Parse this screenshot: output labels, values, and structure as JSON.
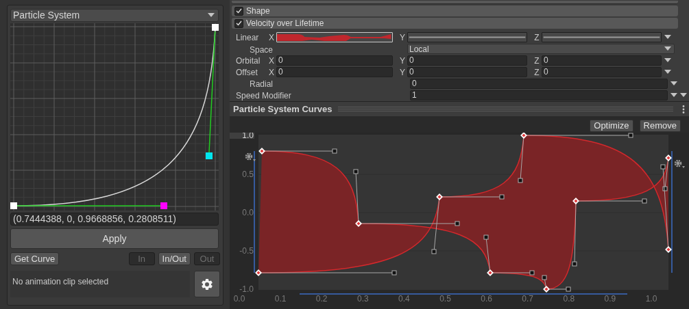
{
  "left_panel": {
    "source_dropdown": "Particle System",
    "curve_value": "(0.7444388, 0, 0.9668856, 0.2808511)",
    "apply_button": "Apply",
    "get_curve_button": "Get Curve",
    "tangent_modes": [
      {
        "label": "In",
        "selected": false
      },
      {
        "label": "In/Out",
        "selected": true
      },
      {
        "label": "Out",
        "selected": false
      }
    ],
    "status": "No animation clip selected"
  },
  "modules": [
    {
      "label": "Shape",
      "checked": true
    },
    {
      "label": "Velocity over Lifetime",
      "checked": true
    }
  ],
  "properties": [
    {
      "kind": "curves",
      "label": "Linear",
      "indented": false,
      "axes": [
        {
          "axis": "X",
          "selected": true
        },
        {
          "axis": "Y",
          "selected": false
        },
        {
          "axis": "Z",
          "selected": false
        }
      ]
    },
    {
      "kind": "dropdown",
      "label": "Space",
      "indented": true,
      "value": "Local"
    },
    {
      "kind": "vector",
      "label": "Orbital",
      "indented": false,
      "fields": [
        {
          "axis": "X",
          "value": "0"
        },
        {
          "axis": "Y",
          "value": "0"
        },
        {
          "axis": "Z",
          "value": "0"
        }
      ]
    },
    {
      "kind": "vector",
      "label": "Offset",
      "indented": false,
      "fields": [
        {
          "axis": "X",
          "value": "0"
        },
        {
          "axis": "Y",
          "value": "0"
        },
        {
          "axis": "Z",
          "value": "0"
        }
      ]
    },
    {
      "kind": "number",
      "label": "Radial",
      "indented": true,
      "value": "0"
    },
    {
      "kind": "number",
      "label": "Speed Modifier",
      "indented": false,
      "value": "1"
    }
  ],
  "curves_panel": {
    "title": "Particle System Curves",
    "buttons": [
      "Optimize",
      "Remove"
    ],
    "y_labels": [
      "1.0",
      "0.5",
      "0.0",
      "-0.5",
      "-1.0"
    ],
    "x_labels": [
      "0.0",
      "0.1",
      "0.2",
      "0.3",
      "0.4",
      "0.5",
      "0.6",
      "0.7",
      "0.8",
      "0.9",
      "1.0"
    ]
  }
}
